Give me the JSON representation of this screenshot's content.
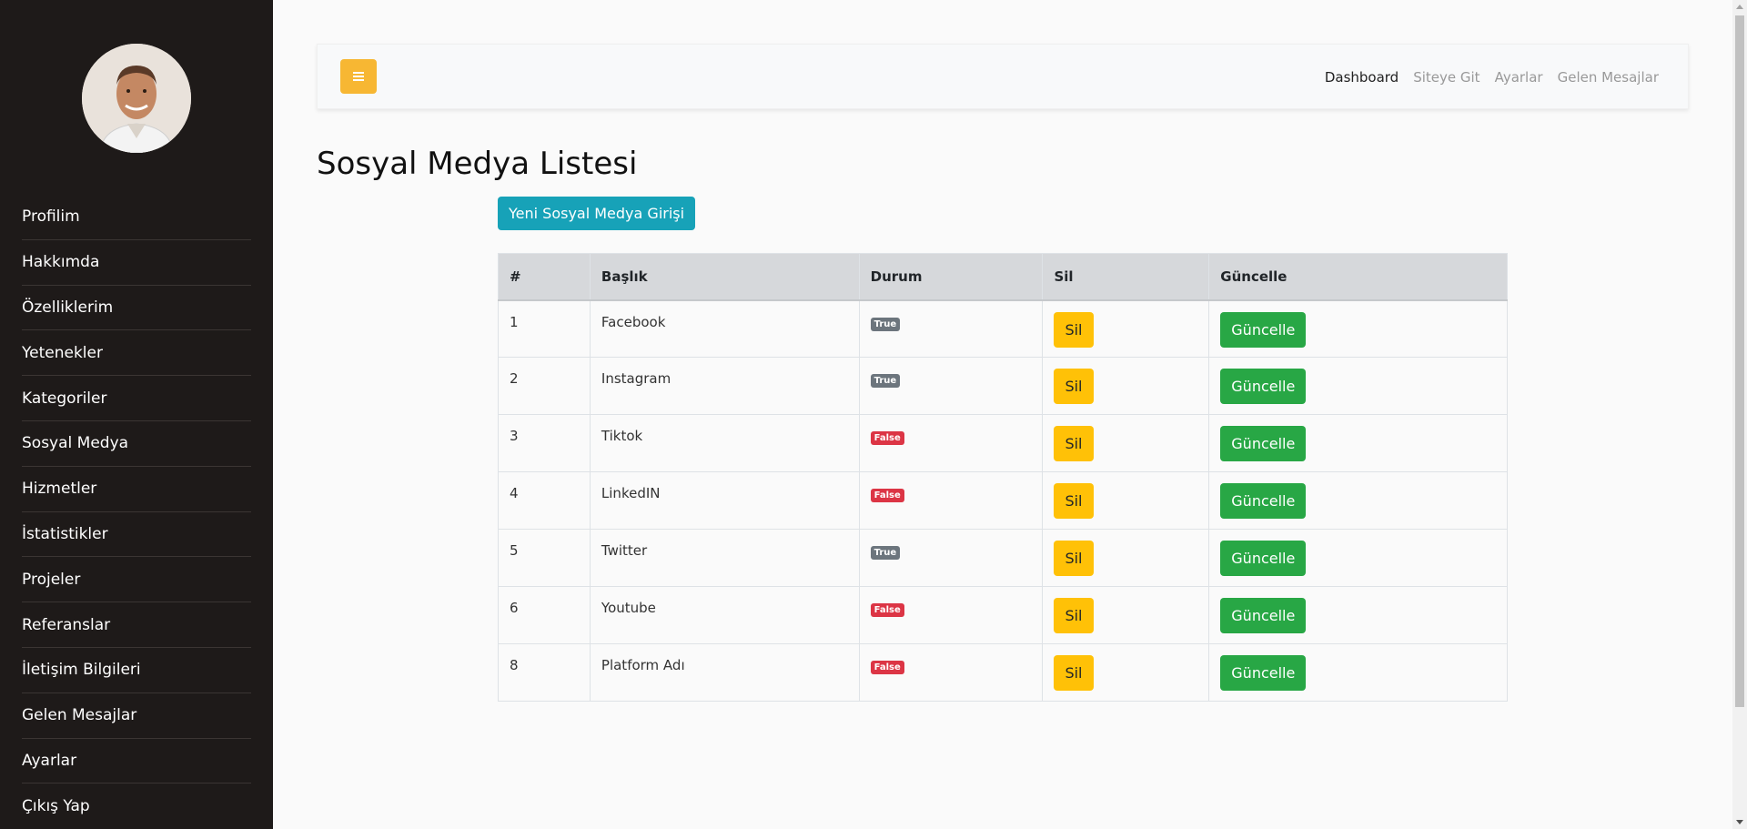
{
  "sidebar": {
    "items": [
      {
        "label": "Profilim"
      },
      {
        "label": "Hakkımda"
      },
      {
        "label": "Özelliklerim"
      },
      {
        "label": "Yetenekler"
      },
      {
        "label": "Kategoriler"
      },
      {
        "label": "Sosyal Medya"
      },
      {
        "label": "Hizmetler"
      },
      {
        "label": "İstatistikler"
      },
      {
        "label": "Projeler"
      },
      {
        "label": "Referanslar"
      },
      {
        "label": "İletişim Bilgileri"
      },
      {
        "label": "Gelen Mesajlar"
      },
      {
        "label": "Ayarlar"
      },
      {
        "label": "Çıkış Yap"
      }
    ]
  },
  "topbar": {
    "toggle_icon": "bars-icon",
    "nav": [
      {
        "label": "Dashboard",
        "active": true
      },
      {
        "label": "Siteye Git"
      },
      {
        "label": "Ayarlar"
      },
      {
        "label": "Gelen Mesajlar"
      }
    ]
  },
  "page": {
    "title": "Sosyal Medya Listesi",
    "new_button": "Yeni Sosyal Medya Girişi"
  },
  "table": {
    "headers": [
      "#",
      "Başlık",
      "Durum",
      "Sil",
      "Güncelle"
    ],
    "delete_label": "Sil",
    "update_label": "Güncelle",
    "rows": [
      {
        "id": "1",
        "title": "Facebook",
        "status": "True"
      },
      {
        "id": "2",
        "title": "Instagram",
        "status": "True"
      },
      {
        "id": "3",
        "title": "Tiktok",
        "status": "False"
      },
      {
        "id": "4",
        "title": "LinkedIN",
        "status": "False"
      },
      {
        "id": "5",
        "title": "Twitter",
        "status": "True"
      },
      {
        "id": "6",
        "title": "Youtube",
        "status": "False"
      },
      {
        "id": "8",
        "title": "Platform Adı",
        "status": "False"
      }
    ]
  },
  "colors": {
    "sidebar_bg": "#1e1a19",
    "toggle": "#f7b733",
    "info": "#17a2b8",
    "warning": "#ffc107",
    "success": "#28a745",
    "danger": "#dc3545",
    "secondary": "#6c757d"
  }
}
